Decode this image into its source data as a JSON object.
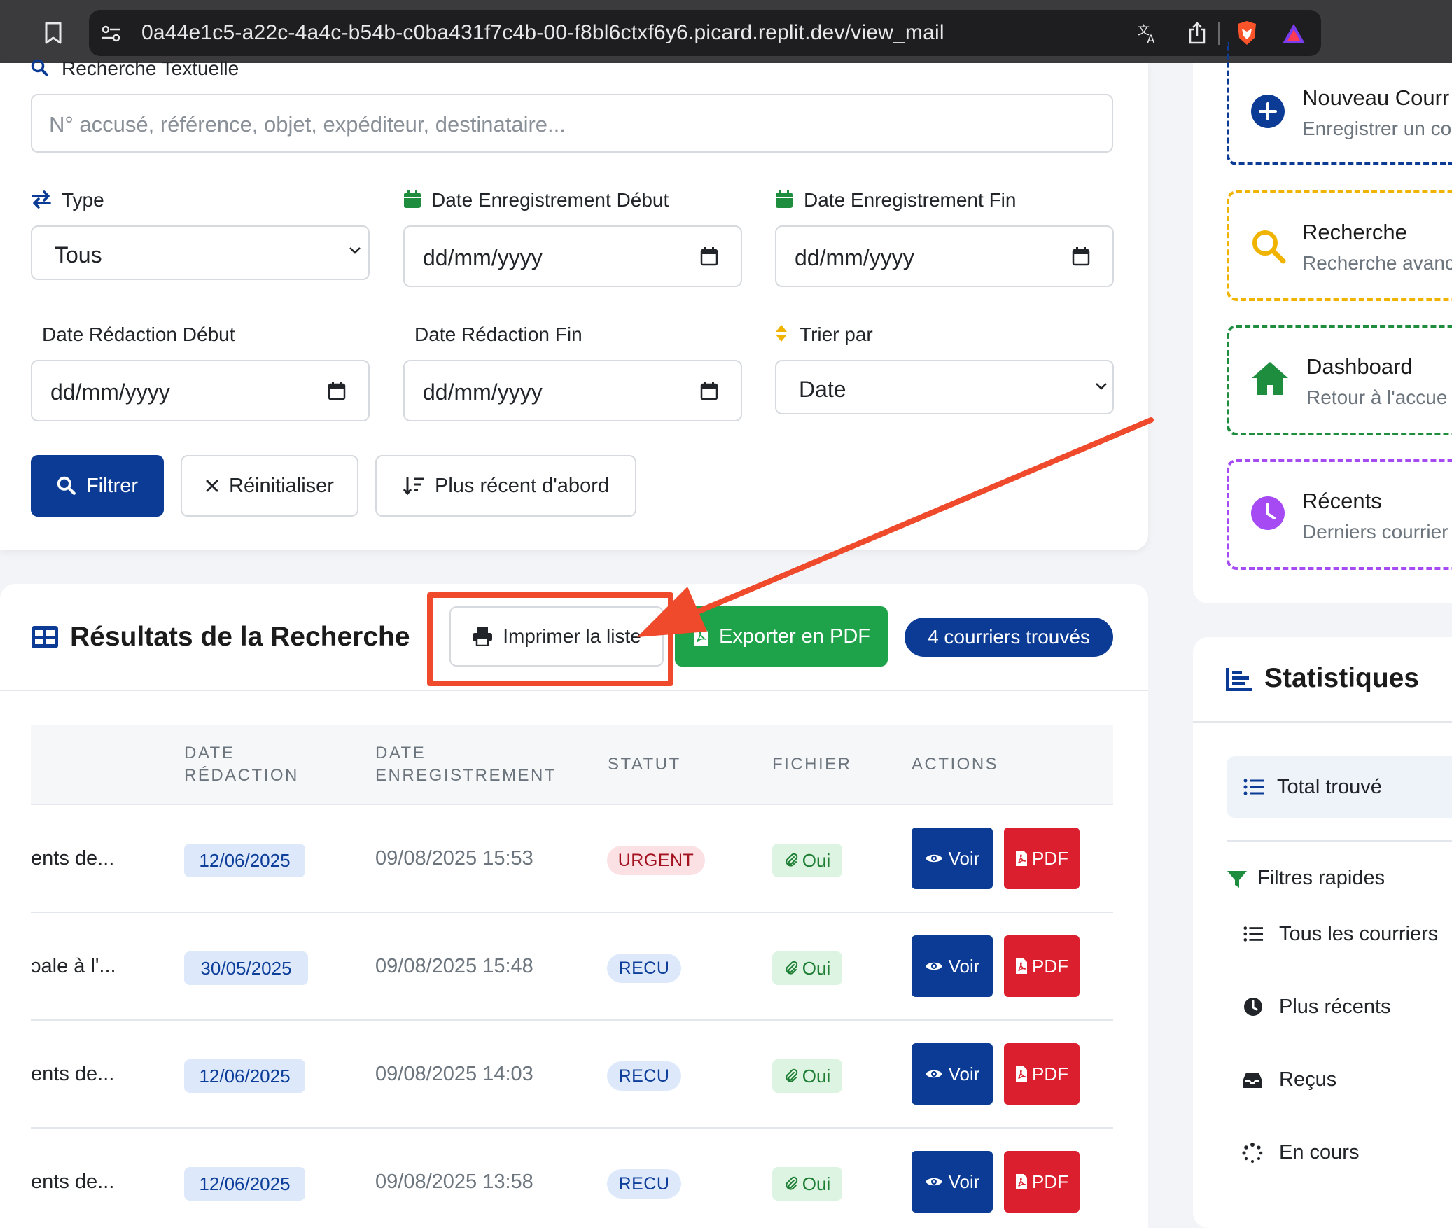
{
  "browser": {
    "url": "0a44e1c5-a22c-4a4c-b54b-c0ba431f7c4b-00-f8bl6ctxf6y6.picard.replit.dev/view_mail"
  },
  "filters": {
    "text_search_label": "Recherche Textuelle",
    "text_search_placeholder": "N° accusé, référence, objet, expéditeur, destinataire...",
    "type_label": "Type",
    "type_value": "Tous",
    "reg_start_label": "Date Enregistrement Début",
    "reg_start_value": "dd/mm/yyyy",
    "reg_end_label": "Date Enregistrement Fin",
    "reg_end_value": "dd/mm/yyyy",
    "red_start_label": "Date Rédaction Début",
    "red_start_value": "dd/mm/yyyy",
    "red_end_label": "Date Rédaction Fin",
    "red_end_value": "dd/mm/yyyy",
    "sort_label": "Trier par",
    "sort_value": "Date",
    "filter_button": "Filtrer",
    "reset_button": "Réinitialiser",
    "recent_button": "Plus récent d'abord"
  },
  "results": {
    "title": "Résultats de la Recherche",
    "print_button": "Imprimer la liste",
    "export_button": "Exporter en PDF",
    "count_badge": "4 courriers trouvés",
    "columns": {
      "date_redaction_1": "DATE",
      "date_redaction_2": "RÉDACTION",
      "date_enregistrement_1": "DATE",
      "date_enregistrement_2": "ENREGISTREMENT",
      "statut": "STATUT",
      "fichier": "FICHIER",
      "actions": "ACTIONS"
    },
    "rows": [
      {
        "object": "ents de...",
        "date_redaction": "12/06/2025",
        "date_enregistrement": "09/08/2025 15:53",
        "statut": "URGENT",
        "fichier": "Oui",
        "voir": "Voir",
        "pdf": "PDF"
      },
      {
        "object": "ɔale à l'...",
        "date_redaction": "30/05/2025",
        "date_enregistrement": "09/08/2025 15:48",
        "statut": "RECU",
        "fichier": "Oui",
        "voir": "Voir",
        "pdf": "PDF"
      },
      {
        "object": "ents de...",
        "date_redaction": "12/06/2025",
        "date_enregistrement": "09/08/2025 14:03",
        "statut": "RECU",
        "fichier": "Oui",
        "voir": "Voir",
        "pdf": "PDF"
      },
      {
        "object": "ents de...",
        "date_redaction": "12/06/2025",
        "date_enregistrement": "09/08/2025 13:58",
        "statut": "RECU",
        "fichier": "Oui",
        "voir": "Voir",
        "pdf": "PDF"
      }
    ]
  },
  "quick_actions": [
    {
      "title": "Nouveau Courr",
      "subtitle": "Enregistrer un co",
      "icon": "plus-circle-icon",
      "color": "#0b3b94"
    },
    {
      "title": "Recherche",
      "subtitle": "Recherche avanc",
      "icon": "search-icon",
      "color": "#f0b400"
    },
    {
      "title": "Dashboard",
      "subtitle": "Retour à l'accue",
      "icon": "home-icon",
      "color": "#1e8e3e"
    },
    {
      "title": "Récents",
      "subtitle": "Derniers courrier",
      "icon": "clock-icon",
      "color": "#a64bf4"
    }
  ],
  "stats": {
    "title": "Statistiques",
    "total_label": "Total trouvé",
    "quick_filters_label": "Filtres rapides",
    "quick_filters": [
      "Tous les courriers",
      "Plus récents",
      "Reçus",
      "En cours"
    ]
  },
  "colors": {
    "primary": "#0b3b94",
    "success": "#1ea34a",
    "danger": "#dc1f2f",
    "annotation": "#ef4a2b"
  }
}
